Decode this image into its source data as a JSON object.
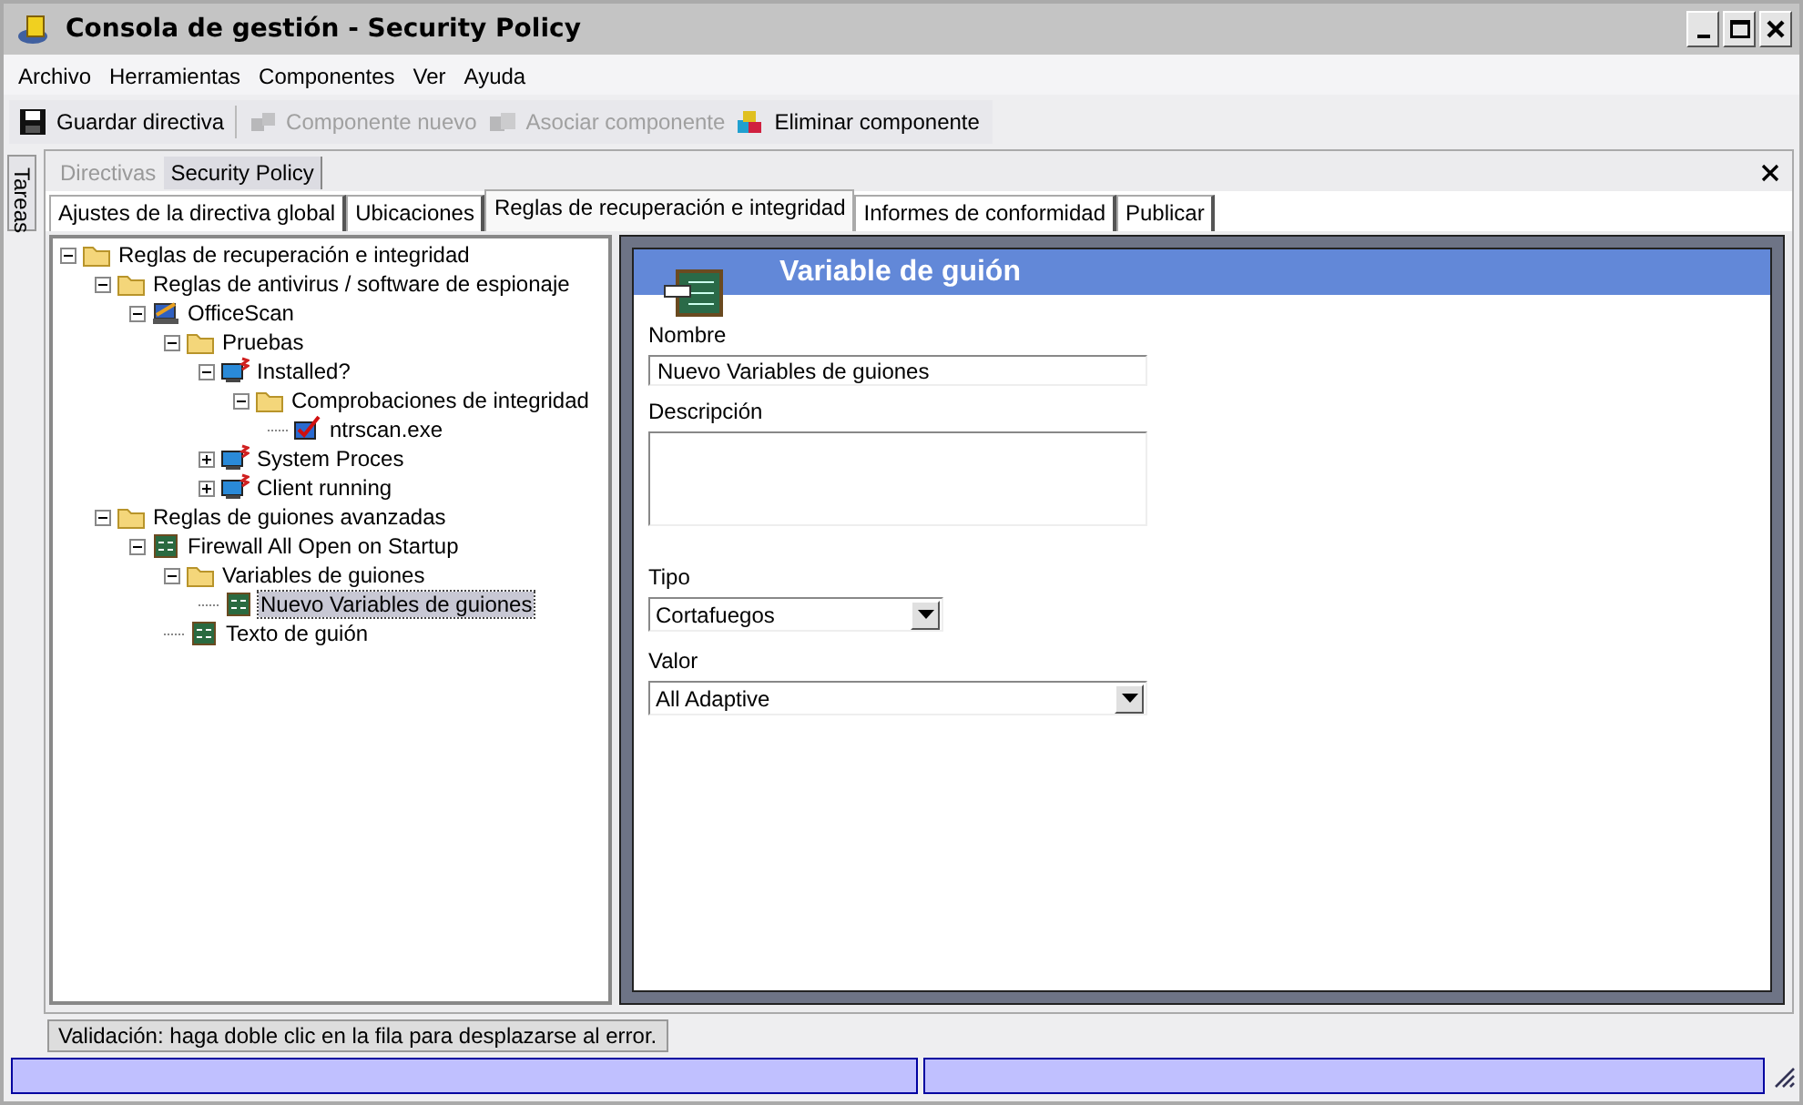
{
  "window": {
    "title": "Consola de gestión - Security Policy"
  },
  "menu": [
    "Archivo",
    "Herramientas",
    "Componentes",
    "Ver",
    "Ayuda"
  ],
  "toolbar": [
    {
      "label": "Guardar directiva",
      "kind": "save",
      "disabled": false
    },
    {
      "label": "Componente nuevo",
      "kind": "new",
      "disabled": true
    },
    {
      "label": "Asociar componente",
      "kind": "link",
      "disabled": true
    },
    {
      "label": "Eliminar componente",
      "kind": "delete",
      "disabled": false
    }
  ],
  "side_tab": "Tareas",
  "document_tabs": [
    {
      "label": "Directivas",
      "selected": false
    },
    {
      "label": "Security Policy",
      "selected": true
    }
  ],
  "tabs": [
    {
      "label": "Ajustes de la directiva global",
      "selected": false
    },
    {
      "label": "Ubicaciones",
      "selected": false
    },
    {
      "label": "Reglas de recuperación e integridad",
      "selected": true
    },
    {
      "label": "Informes de conformidad",
      "selected": false
    },
    {
      "label": "Publicar",
      "selected": false
    }
  ],
  "tree": [
    {
      "label": "Reglas de recuperación e integridad",
      "kind": "folder",
      "expanded": true,
      "selected": false,
      "children": [
        {
          "label": "Reglas de antivirus / software de espionaje",
          "kind": "folder",
          "expanded": true,
          "selected": false,
          "children": [
            {
              "label": "OfficeScan",
              "kind": "product",
              "expanded": true,
              "selected": false,
              "children": [
                {
                  "label": "Pruebas",
                  "kind": "folder",
                  "expanded": true,
                  "selected": false,
                  "children": [
                    {
                      "label": "Installed?",
                      "kind": "test",
                      "expanded": true,
                      "selected": false,
                      "children": [
                        {
                          "label": "Comprobaciones de integridad",
                          "kind": "folder",
                          "expanded": true,
                          "selected": false,
                          "children": [
                            {
                              "label": "ntrscan.exe",
                              "kind": "check",
                              "selected": false
                            }
                          ]
                        }
                      ]
                    },
                    {
                      "label": "System Proces",
                      "kind": "test",
                      "expanded": false,
                      "selected": false
                    },
                    {
                      "label": "Client running",
                      "kind": "test",
                      "expanded": false,
                      "selected": false
                    }
                  ]
                }
              ]
            }
          ]
        },
        {
          "label": "Reglas de guiones avanzadas",
          "kind": "folder",
          "expanded": true,
          "selected": false,
          "children": [
            {
              "label": "Firewall All Open on Startup",
              "kind": "script",
              "expanded": true,
              "selected": false,
              "children": [
                {
                  "label": "Variables de guiones",
                  "kind": "folder",
                  "expanded": true,
                  "selected": false,
                  "children": [
                    {
                      "label": "Nuevo Variables de guiones",
                      "kind": "script",
                      "selected": true
                    }
                  ]
                },
                {
                  "label": "Texto de guión",
                  "kind": "script",
                  "selected": false
                }
              ]
            }
          ]
        }
      ]
    }
  ],
  "panel": {
    "title": "Variable de guión",
    "fields": [
      {
        "label": "Nombre",
        "kind": "text",
        "value": "Nuevo Variables de guiones"
      },
      {
        "label": "Descripción",
        "kind": "textarea"
      },
      {
        "label": "Tipo",
        "kind": "dropdown",
        "value": "Cortafuegos"
      },
      {
        "label": "Valor",
        "kind": "dropdown",
        "value": "All Adaptive"
      }
    ]
  },
  "validation": "Validación: haga doble clic en la fila para desplazarse al error."
}
